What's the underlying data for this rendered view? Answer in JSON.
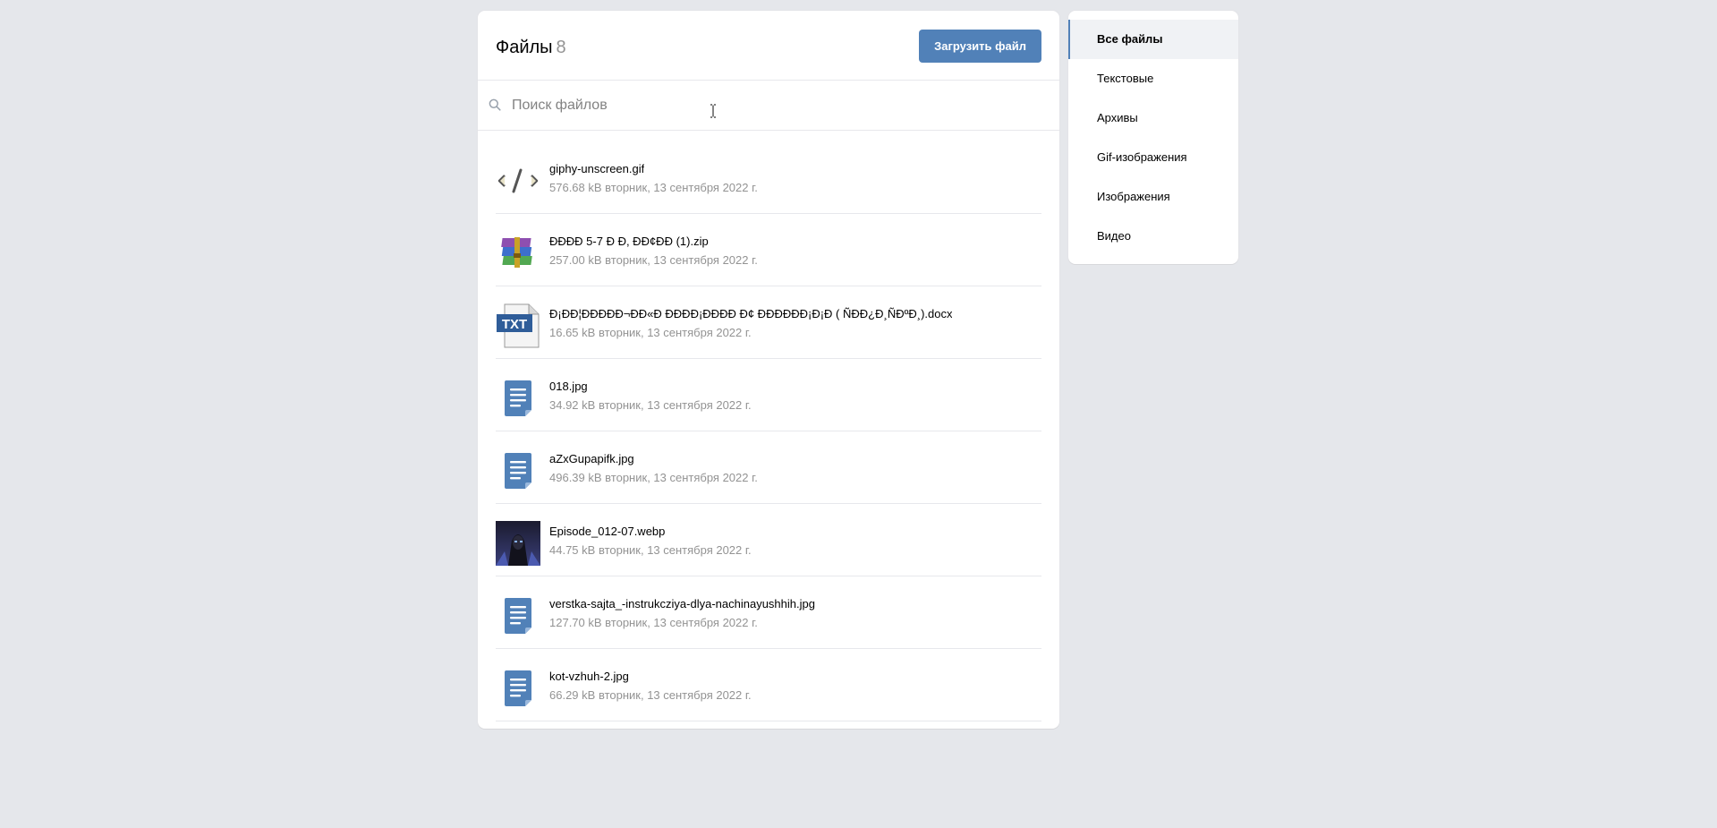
{
  "header": {
    "title": "Файлы",
    "count": "8",
    "upload_label": "Загрузить файл"
  },
  "search": {
    "placeholder": "Поиск файлов",
    "value": ""
  },
  "files": [
    {
      "name": "giphy-unscreen.gif",
      "size": "576.68 kB",
      "date": "вторник, 13 сентября 2022 г.",
      "icon": "gif-code-icon"
    },
    {
      "name": "ÐÐÐÐ 5-7 Ð Ð, ÐÐ¢ÐÐ (1).zip",
      "size": "257.00 kB",
      "date": "вторник, 13 сентября 2022 г.",
      "icon": "archive-icon"
    },
    {
      "name": "Ð¡ÐÐ¦ÐÐÐÐÐ¬ÐÐ«Ð ÐÐÐÐ¡ÐÐÐÐ Ð¢ ÐÐÐÐÐÐ¡Ð¡Ð ( ÑÐÐ¿Ð¸ÑÐºÐ¸).docx",
      "size": "16.65 kB",
      "date": "вторник, 13 сентября 2022 г.",
      "icon": "txt-document-icon"
    },
    {
      "name": "018.jpg",
      "size": "34.92 kB",
      "date": "вторник, 13 сентября 2022 г.",
      "icon": "document-icon"
    },
    {
      "name": "aZxGupapifk.jpg",
      "size": "496.39 kB",
      "date": "вторник, 13 сентября 2022 г.",
      "icon": "document-icon"
    },
    {
      "name": "Episode_012-07.webp",
      "size": "44.75 kB",
      "date": "вторник, 13 сентября 2022 г.",
      "icon": "image-preview-icon"
    },
    {
      "name": "verstka-sajta_-instrukcziya-dlya-nachinayushhih.jpg",
      "size": "127.70 kB",
      "date": "вторник, 13 сентября 2022 г.",
      "icon": "document-icon"
    },
    {
      "name": "kot-vzhuh-2.jpg",
      "size": "66.29 kB",
      "date": "вторник, 13 сентября 2022 г.",
      "icon": "document-icon"
    }
  ],
  "filters": [
    {
      "label": "Все файлы",
      "active": true
    },
    {
      "label": "Текстовые",
      "active": false
    },
    {
      "label": "Архивы",
      "active": false
    },
    {
      "label": "Gif-изображения",
      "active": false
    },
    {
      "label": "Изображения",
      "active": false
    },
    {
      "label": "Видео",
      "active": false
    }
  ],
  "colors": {
    "accent": "#5181b8",
    "background": "#e5e7eb",
    "muted_text": "#939393",
    "doc_icon": "#5181b8"
  }
}
